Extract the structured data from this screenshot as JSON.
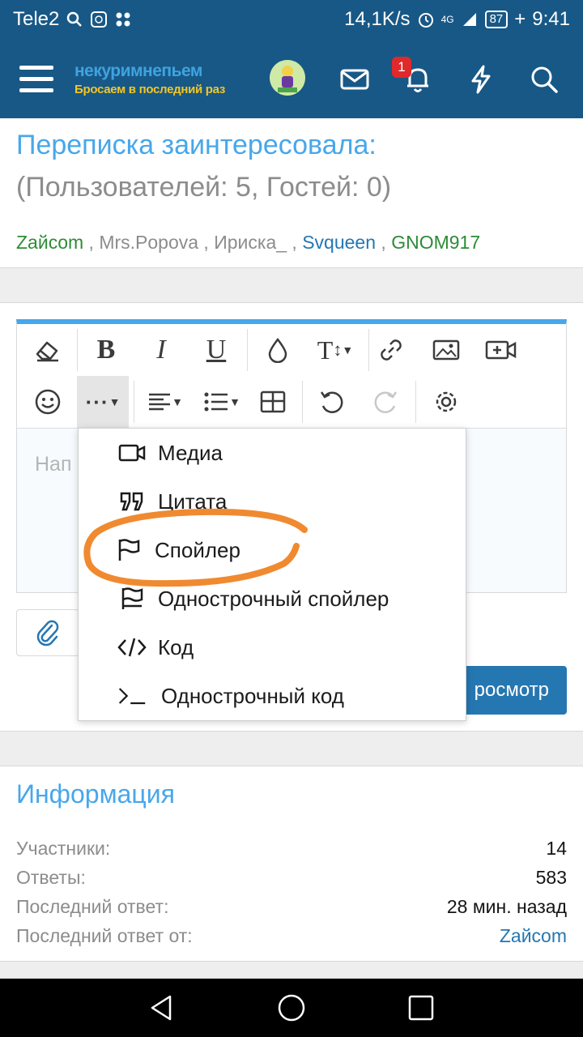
{
  "status_bar": {
    "carrier": "Tele2",
    "net_speed": "14,1K/s",
    "signal": "4G",
    "battery": "87",
    "time": "9:41"
  },
  "app_bar": {
    "logo_title": "некуримнепьем",
    "logo_subtitle": "Бросаем в последний раз",
    "notifications_count": "1",
    "icons": [
      "menu-icon",
      "mail-icon",
      "bell-icon",
      "lightning-icon",
      "search-icon"
    ]
  },
  "watching": {
    "title": "Переписка заинтересовала:",
    "subtitle": "(Пользователей: 5, Гостей: 0)",
    "users": [
      {
        "name": "Zaйсom",
        "color": "#2d8c36"
      },
      {
        "name": "Mrs.Popova",
        "color": "#8c8c8c"
      },
      {
        "name": "Ириска_",
        "color": "#8c8c8c"
      },
      {
        "name": "Svqueen",
        "color": "#2577b1"
      },
      {
        "name": "GNOM917",
        "color": "#2d8c36"
      }
    ],
    "separator": " , "
  },
  "editor": {
    "placeholder": "Нап",
    "toolbar_row1": [
      "eraser-icon",
      "bold-icon",
      "italic-icon",
      "underline-icon",
      "color-drop-icon",
      "text-size-icon",
      "link-icon",
      "image-icon",
      "video-icon"
    ],
    "toolbar_row2": [
      "smiley-icon",
      "more-icon",
      "align-icon",
      "list-icon",
      "table-icon",
      "undo-icon",
      "redo-icon",
      "settings-icon"
    ]
  },
  "insert_menu": {
    "items": [
      {
        "label": "Медиа",
        "icon": "video-camera-icon"
      },
      {
        "label": "Цитата",
        "icon": "quote-icon"
      },
      {
        "label": "Спойлер",
        "icon": "flag-icon"
      },
      {
        "label": "Однострочный спойлер",
        "icon": "inline-flag-icon"
      },
      {
        "label": "Код",
        "icon": "code-icon"
      },
      {
        "label": "Однострочный код",
        "icon": "terminal-icon"
      }
    ],
    "highlighted": "Спойлер"
  },
  "actions": {
    "preview_label": "росмотр"
  },
  "info": {
    "title": "Информация",
    "rows": [
      {
        "label": "Участники:",
        "value": "14"
      },
      {
        "label": "Ответы:",
        "value": "583"
      },
      {
        "label": "Последний ответ:",
        "value": "28 мин. назад"
      },
      {
        "label": "Последний ответ от:",
        "value": "Zaйсom"
      }
    ]
  },
  "colors": {
    "header": "#185886",
    "accent": "#47a7eb",
    "link": "#2577b1",
    "marker": "#f08a30"
  }
}
